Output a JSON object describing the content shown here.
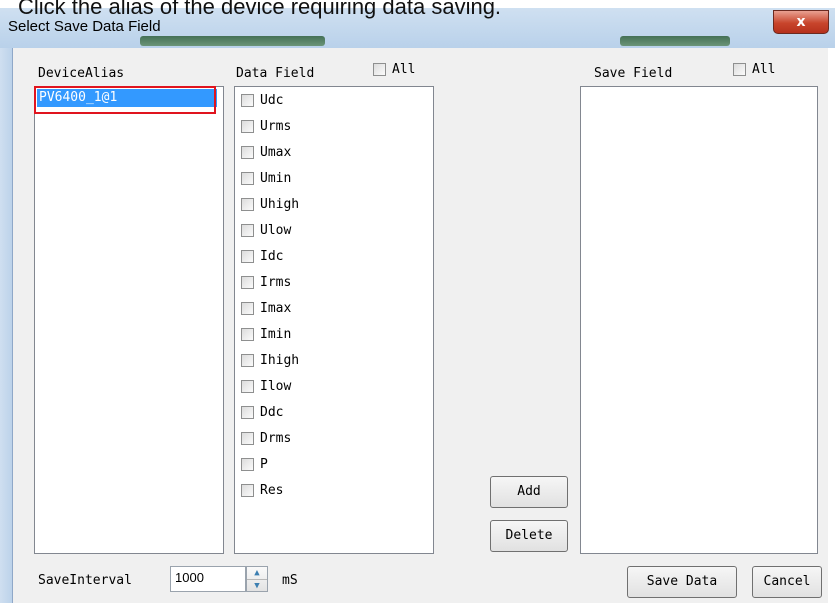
{
  "caption": "Click the alias of the device requiring data saving.",
  "window": {
    "title": "Select Save Data Field",
    "close_label": "x"
  },
  "device_alias": {
    "header": "DeviceAlias",
    "items": [
      "PV6400_1@1"
    ]
  },
  "data_field": {
    "header": "Data Field",
    "all_label": "All",
    "items": [
      "Udc",
      "Urms",
      "Umax",
      "Umin",
      "Uhigh",
      "Ulow",
      "Idc",
      "Irms",
      "Imax",
      "Imin",
      "Ihigh",
      "Ilow",
      "Ddc",
      "Drms",
      "P",
      "Res"
    ]
  },
  "save_field": {
    "header": "Save Field",
    "all_label": "All",
    "items": []
  },
  "buttons": {
    "add": "Add",
    "delete": "Delete",
    "save_data": "Save Data",
    "cancel": "Cancel"
  },
  "interval": {
    "label": "SaveInterval",
    "value": "1000",
    "unit": "mS"
  },
  "colors": {
    "selection": "#3399ff",
    "highlight": "#e0141e"
  }
}
